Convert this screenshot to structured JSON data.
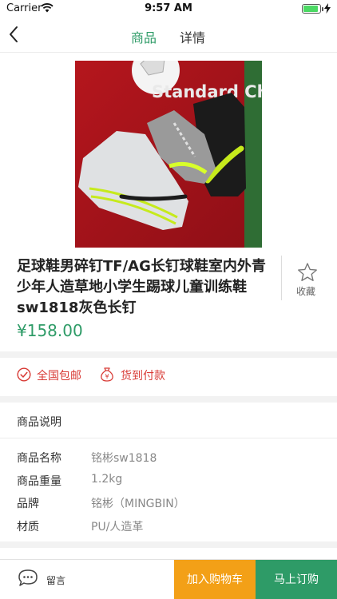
{
  "status_bar": {
    "carrier": "Carrier",
    "time": "9:57 AM"
  },
  "nav": {
    "tabs": [
      {
        "label": "商品",
        "active": true
      },
      {
        "label": "详情",
        "active": false
      }
    ]
  },
  "product": {
    "title": "足球鞋男碎钉TF/AG长钉球鞋室内外青少年人造草地小学生踢球儿童训练鞋 sw1818灰色长钉",
    "price": "¥158.00",
    "favorite_label": "收藏",
    "image_text": "Standard Chartered"
  },
  "services": [
    {
      "icon": "check-circle-icon",
      "label": "全国包邮"
    },
    {
      "icon": "money-bag-icon",
      "label": "货到付款"
    }
  ],
  "description": {
    "heading": "商品说明",
    "specs": [
      {
        "key": "商品名称",
        "value": "铭彬sw1818"
      },
      {
        "key": "商品重量",
        "value": "1.2kg"
      },
      {
        "key": "品牌",
        "value": " 铭彬（MINGBIN）"
      },
      {
        "key": "材质",
        "value": "PU/人造革"
      }
    ]
  },
  "bottom_bar": {
    "message_label": "留言",
    "cart_label": "加入购物车",
    "buy_label": "马上订购"
  },
  "colors": {
    "accent": "#2e9b67",
    "warn": "#d83a35",
    "cart": "#f3a017"
  }
}
